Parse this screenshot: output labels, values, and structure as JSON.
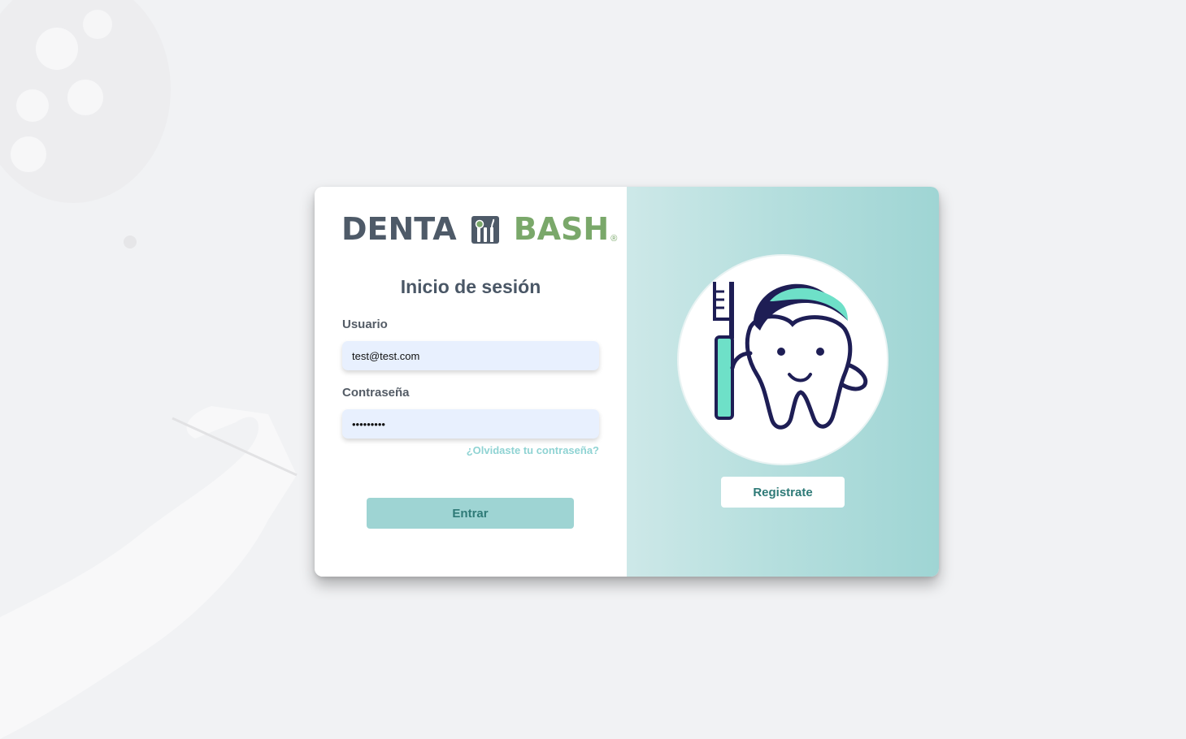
{
  "brand": {
    "word1": "DENTA",
    "word2": "BASH",
    "registered": "®",
    "logo_icon": "dental-tools-icon",
    "colors": {
      "dark": "#4e5a68",
      "green": "#7aa86a"
    }
  },
  "login": {
    "title": "Inicio de sesión",
    "username_label": "Usuario",
    "username_value": "test@test.com",
    "password_label": "Contraseña",
    "password_value": "•••••••••",
    "forgot_link": "¿Olvidaste tu contraseña?",
    "submit_label": "Entrar"
  },
  "register": {
    "illustration": "tooth-with-toothbrush-icon",
    "button_label": "Registrate"
  },
  "theme": {
    "accent": "#9ed4d3",
    "accent_text": "#2e7a77",
    "input_bg": "#e8f0fe"
  }
}
